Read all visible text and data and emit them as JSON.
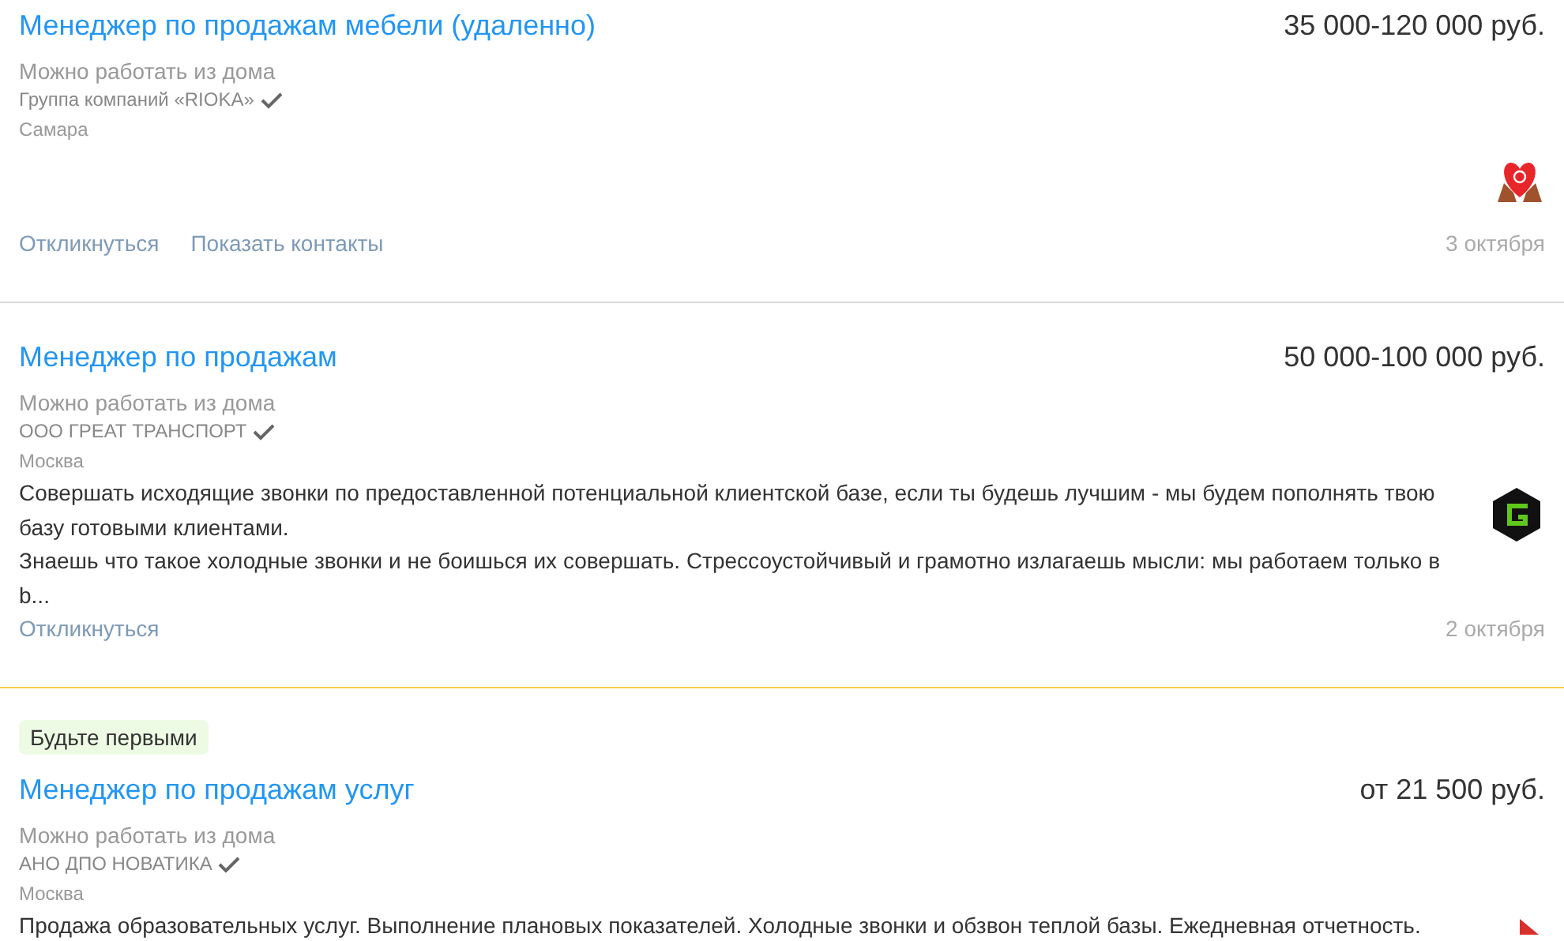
{
  "vacancies": [
    {
      "title": "Менеджер по продажам мебели (удаленно)",
      "salary": "35 000-120 000 руб.",
      "remote": "Можно работать из дома",
      "company": "Группа компаний «RIOKA»",
      "verified": true,
      "city": "Самара",
      "kind": "heart",
      "actions": [
        "Откликнуться",
        "Показать контакты"
      ],
      "date": "3 октября"
    },
    {
      "highlighted": false,
      "title": "Менеджер по продажам",
      "salary": "50 000-100 000 руб.",
      "remote": "Можно работать из дома",
      "company": "ООО ГРЕАТ ТРАНСПОРТ",
      "verified": true,
      "city": "Москва",
      "description": [
        "Совершать исходящие звонки по предоставленной потенциальной клиентской базе, если ты будешь лучшим - мы будем пополнять твою базу готовыми клиентами.",
        "Знаешь что такое холодные звонки и не боишься их совершать. Стрессоустойчивый и грамотно излагаешь мысли: мы работаем только в b..."
      ],
      "kind": "hexagon",
      "actions": [
        "Откликнуться"
      ],
      "date": "2 октября"
    },
    {
      "highlighted": true,
      "badge": "Будьте первыми",
      "title": "Менеджер по продажам услуг",
      "salary": "от 21 500 руб.",
      "remote": "Можно работать из дома",
      "company": "АНО ДПО НОВАТИКА",
      "verified": true,
      "city": "Москва",
      "description": [
        "Продажа образовательных услуг. Выполнение плановых показателей. Холодные звонки и обзвон теплой базы. Ежедневная отчетность."
      ],
      "kind": "arrow"
    }
  ]
}
